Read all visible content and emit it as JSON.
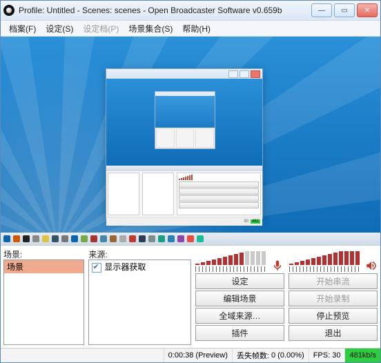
{
  "title": "Profile: Untitled - Scenes: scenes - Open Broadcaster Software v0.659b",
  "menu": {
    "file": "档案(F)",
    "settings": "设定(S)",
    "profiles": "设定档(P)",
    "sceneCollections": "场景集合(S)",
    "help": "帮助(H)"
  },
  "panels": {
    "scenes_label": "场景:",
    "sources_label": "来源:",
    "scene_items": [
      "场景"
    ],
    "source_items": [
      "显示器获取"
    ]
  },
  "buttons": {
    "settings": "设定",
    "edit_scene": "编辑场景",
    "start_stream": "开始串流",
    "start_record": "开始录制",
    "global_sources": "全域来源…",
    "stop_preview": "停止预览",
    "plugins": "插件",
    "exit": "退出"
  },
  "status": {
    "time": "0:00:38 (Preview)",
    "dropped_label": "丢失帧数:",
    "dropped_value": "0 (0.00%)",
    "fps_label": "FPS:",
    "fps_value": "30",
    "bitrate": "481kb/s"
  },
  "chart_data": [
    {
      "type": "bar",
      "title": "Mic level",
      "values": [
        2,
        4,
        6,
        8,
        10,
        12,
        14,
        16,
        18,
        20,
        20,
        20,
        20
      ],
      "active_bars": 9,
      "ylim": [
        0,
        22
      ]
    },
    {
      "type": "bar",
      "title": "Speaker level",
      "values": [
        2,
        4,
        6,
        8,
        10,
        12,
        14,
        16,
        18,
        20,
        20,
        20,
        20
      ],
      "active_bars": 13,
      "ylim": [
        0,
        22
      ]
    }
  ],
  "taskbar_icons": [
    "#0a64ad",
    "#d35400",
    "#222",
    "#888",
    "#e0c341",
    "#356",
    "#777",
    "#0a64ad",
    "#7a4",
    "#a33",
    "#48a",
    "#963",
    "#aaa",
    "#c0392b",
    "#2c3e50",
    "#7f8c8d",
    "#16a085",
    "#2980b9",
    "#8e44ad",
    "#e74c3c",
    "#1abc9c"
  ]
}
